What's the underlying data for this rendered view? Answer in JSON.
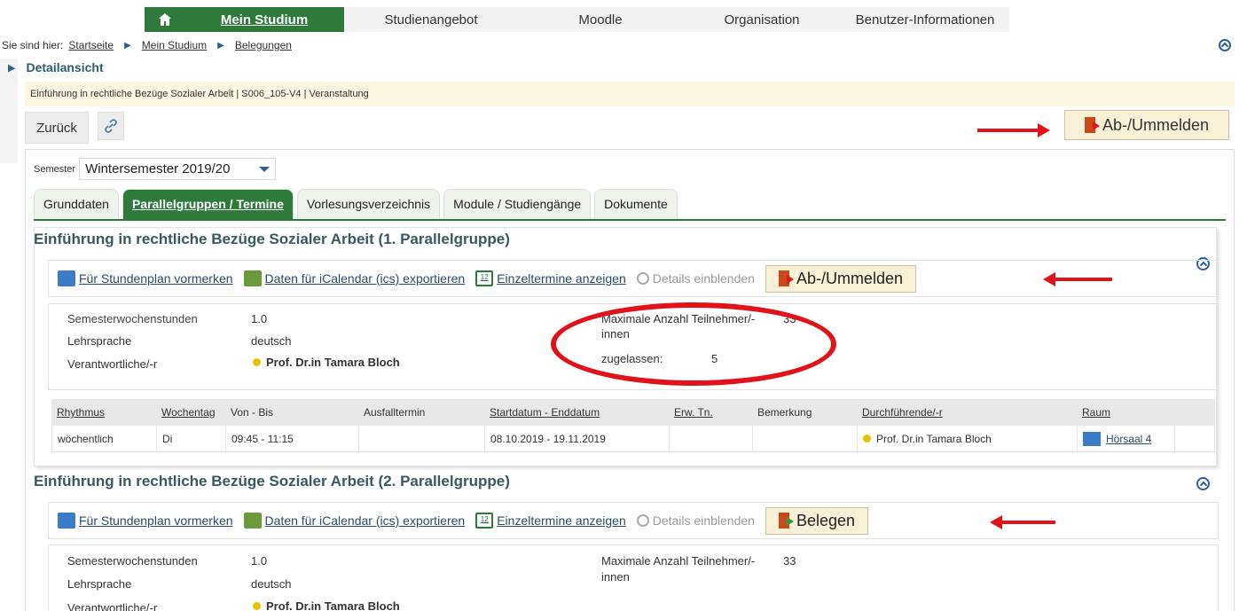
{
  "nav": {
    "items": [
      {
        "label": "Mein Studium",
        "active": true
      },
      {
        "label": "Studienangebot"
      },
      {
        "label": "Moodle"
      },
      {
        "label": "Organisation"
      },
      {
        "label": "Benutzer-Informationen"
      }
    ]
  },
  "breadcrumb": {
    "prefix": "Sie sind hier:",
    "items": [
      "Startseite",
      "Mein Studium",
      "Belegungen"
    ]
  },
  "page": {
    "title": "Detailansicht",
    "info": "Einführung in rechtliche Bezüge Sozialer Arbeit | S006_105-V4 | Veranstaltung",
    "back": "Zurück",
    "ab_ummelden": "Ab-/Ummelden"
  },
  "semester": {
    "label": "Semester",
    "value": "Wintersemester 2019/20"
  },
  "tabs": [
    {
      "label": "Grunddaten"
    },
    {
      "label": "Parallelgruppen / Termine",
      "active": true
    },
    {
      "label": "Vorlesungsverzeichnis"
    },
    {
      "label": "Module / Studiengänge"
    },
    {
      "label": "Dokumente"
    }
  ],
  "actions": {
    "plan": "Für Stundenplan vormerken",
    "ics": "Daten für iCalendar (ics) exportieren",
    "einzel": "Einzeltermine anzeigen",
    "details": "Details einblenden"
  },
  "groups": [
    {
      "title": "Einführung in rechtliche Bezüge Sozialer Arbeit (1. Parallelgruppe)",
      "action_button": "Ab-/Ummelden",
      "sws_label": "Semesterwochenstunden",
      "sws": "1.0",
      "sprache_label": "Lehrsprache",
      "sprache": "deutsch",
      "verantw_label": "Verantwortliche/-r",
      "verantw": "Prof. Dr.in Tamara Bloch",
      "max_label_1": "Maximale Anzahl Teilnehmer/-",
      "max_label_2": "innen",
      "max": "33",
      "zugelassen_label": "zugelassen:",
      "zugelassen": "5"
    },
    {
      "title": "Einführung in rechtliche Bezüge Sozialer Arbeit (2. Parallelgruppe)",
      "action_button": "Belegen",
      "sws_label": "Semesterwochenstunden",
      "sws": "1.0",
      "sprache_label": "Lehrsprache",
      "sprache": "deutsch",
      "verantw_label": "Verantwortliche/-r",
      "verantw": "Prof. Dr.in Tamara Bloch",
      "max_label_1": "Maximale Anzahl Teilnehmer/-",
      "max_label_2": "innen",
      "max": "33"
    }
  ],
  "schedule": {
    "headers": [
      "Rhythmus",
      "Wochentag",
      "Von - Bis",
      "Ausfalltermin",
      "Startdatum - Enddatum",
      "Erw. Tn.",
      "Bemerkung",
      "Durchführende/-r",
      "Raum"
    ],
    "row": [
      "wöchentlich",
      "Di",
      "09:45 - 11:15",
      "",
      "08.10.2019 - 19.11.2019",
      "",
      "",
      "Prof. Dr.in Tamara Bloch",
      "Hörsaal 4"
    ]
  }
}
